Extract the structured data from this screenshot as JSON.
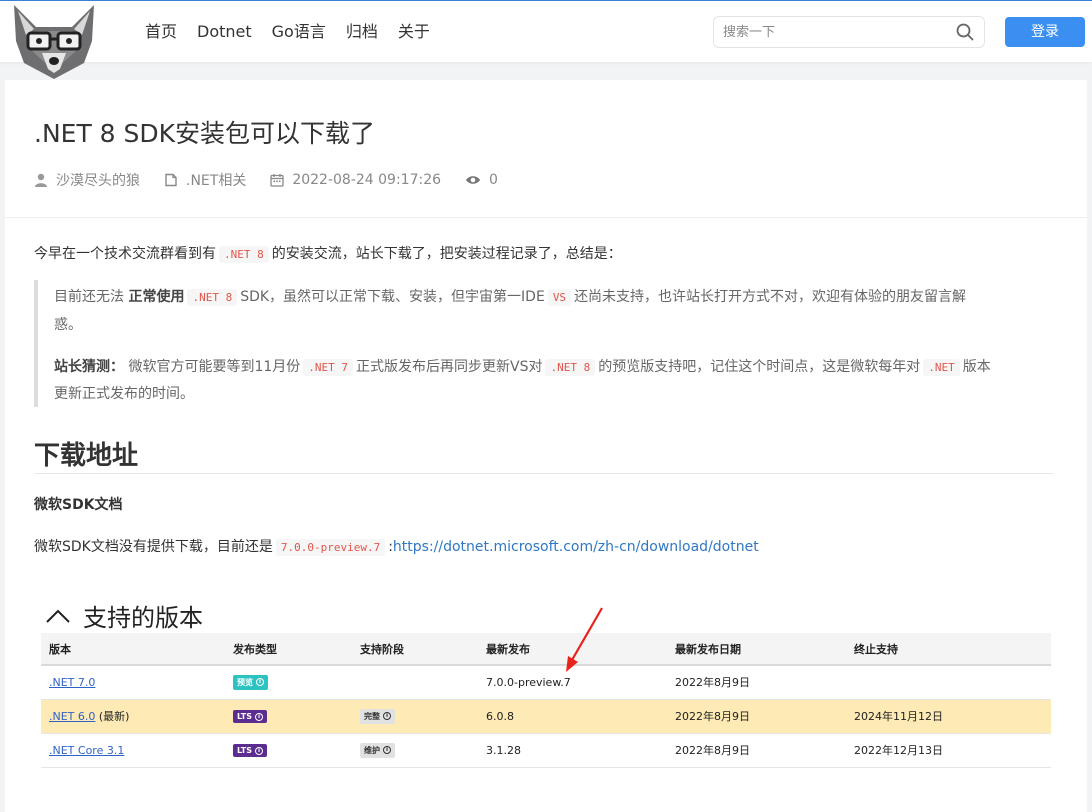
{
  "header": {
    "nav": [
      "首页",
      "Dotnet",
      "Go语言",
      "归档",
      "关于"
    ],
    "search_placeholder": "搜索一下",
    "login_label": "登录"
  },
  "article": {
    "title": ".NET 8 SDK安装包可以下载了",
    "meta": {
      "author": "沙漠尽头的狼",
      "category": ".NET相关",
      "date": "2022-08-24 09:17:26",
      "views": "0"
    },
    "intro": {
      "before": "今早在一个技术交流群看到有",
      "code": ".NET 8",
      "after": "的安装交流，站长下载了，把安装过程记录了，总结是："
    },
    "quote": {
      "line1_a": "目前还无法 ",
      "line1_bold": "正常使用",
      "line1_code1": ".NET 8",
      "line1_b": "SDK，虽然可以正常下载、安装，但宇宙第一IDE",
      "line1_code2": "VS",
      "line1_c": "还尚未支持，也许站长打开方式不对，欢迎有体验的朋友留言解",
      "line2": "惑。",
      "line3_bold": "站长猜测：",
      "line3_a": " 微软官方可能要等到11月份",
      "line3_code1": ".NET 7",
      "line3_b": "正式版发布后再同步更新VS对",
      "line3_code2": ".NET 8",
      "line3_c": "的预览版支持吧，记住这个时间点，这是微软每年对",
      "line3_code3": ".NET",
      "line3_d": "版本",
      "line4": "更新正式发布的时间。"
    },
    "section_title": "下载地址",
    "subsection_title": "微软SDK文档",
    "download": {
      "before": "微软SDK文档没有提供下载，目前还是",
      "code": "7.0.0-preview.7",
      "colon": ":",
      "link": "https://dotnet.microsoft.com/zh-cn/download/dotnet"
    }
  },
  "versions": {
    "title": "支持的版本",
    "headers": [
      "版本",
      "发布类型",
      "支持阶段",
      "最新发布",
      "最新发布日期",
      "终止支持"
    ],
    "rows": [
      {
        "version": ".NET 7.0",
        "suffix": "",
        "type": "预览",
        "phase": "",
        "latest": "7.0.0-preview.7",
        "date": "2022年8月9日",
        "eol": ""
      },
      {
        "version": ".NET 6.0",
        "suffix": " (最新)",
        "type": "LTS",
        "phase": "完整",
        "latest": "6.0.8",
        "date": "2022年8月9日",
        "eol": "2024年11月12日"
      },
      {
        "version": ".NET Core 3.1",
        "suffix": "",
        "type": "LTS",
        "phase": "维护",
        "latest": "3.1.28",
        "date": "2022年8月9日",
        "eol": "2022年12月13日"
      }
    ],
    "info_glyph": "i"
  },
  "icons": {
    "logo": "wolf-logo-icon",
    "search": "search-icon",
    "author": "user-icon",
    "category": "folder-icon",
    "date": "calendar-icon",
    "views": "eye-icon",
    "collapse": "chevron-up-icon",
    "annotation": "red-arrow-icon"
  },
  "colors": {
    "accent": "#3b8ff0",
    "code_text": "#e0564c",
    "link": "#2f78c4",
    "highlight_row": "#fdeab4",
    "annotation_arrow": "#e8231c"
  }
}
